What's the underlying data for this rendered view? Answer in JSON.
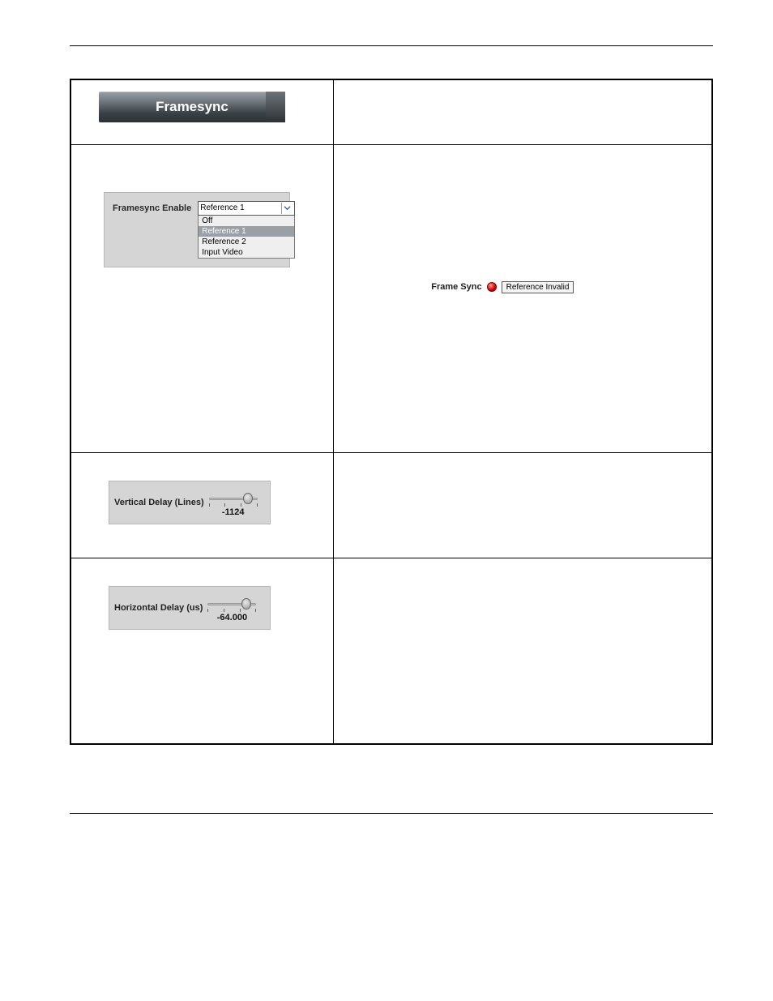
{
  "banner": {
    "title": "Framesync"
  },
  "framesync_enable": {
    "label": "Framesync Enable",
    "selected": "Reference 1",
    "options": [
      "Off",
      "Reference 1",
      "Reference 2",
      "Input Video"
    ],
    "selected_index": 1
  },
  "status": {
    "label": "Frame Sync",
    "value": "Reference Invalid",
    "color": "#d40000"
  },
  "vertical_delay": {
    "label": "Vertical Delay (Lines)",
    "value": "-1124"
  },
  "horizontal_delay": {
    "label": "Horizontal Delay (us)",
    "value": "-64.000"
  }
}
